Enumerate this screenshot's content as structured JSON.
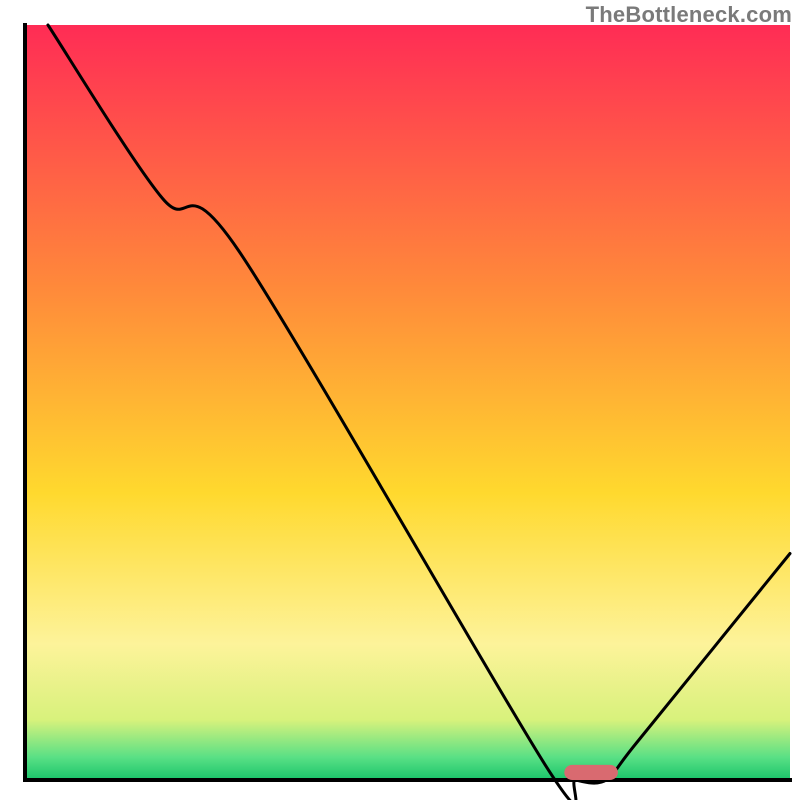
{
  "watermark": "TheBottleneck.com",
  "chart_data": {
    "type": "line",
    "title": "",
    "xlabel": "",
    "ylabel": "",
    "xlim": [
      0,
      100
    ],
    "ylim": [
      0,
      100
    ],
    "grid": false,
    "legend": false,
    "series": [
      {
        "name": "bottleneck-curve",
        "x": [
          3,
          18,
          28,
          68,
          72,
          76,
          80,
          100
        ],
        "y": [
          100,
          77,
          70,
          2,
          0,
          0,
          5,
          30
        ]
      }
    ],
    "marker": {
      "name": "optimum-pill",
      "x": 74,
      "y": 1,
      "width": 7,
      "height": 2,
      "color": "#d96a70"
    },
    "gradient_stops": [
      {
        "offset": 0.0,
        "color": "#ff2c55"
      },
      {
        "offset": 0.35,
        "color": "#ff8a3a"
      },
      {
        "offset": 0.62,
        "color": "#ffd92e"
      },
      {
        "offset": 0.82,
        "color": "#fdf39a"
      },
      {
        "offset": 0.92,
        "color": "#d8f27c"
      },
      {
        "offset": 0.97,
        "color": "#59e085"
      },
      {
        "offset": 1.0,
        "color": "#19c46a"
      }
    ],
    "axis_color": "#000000"
  }
}
